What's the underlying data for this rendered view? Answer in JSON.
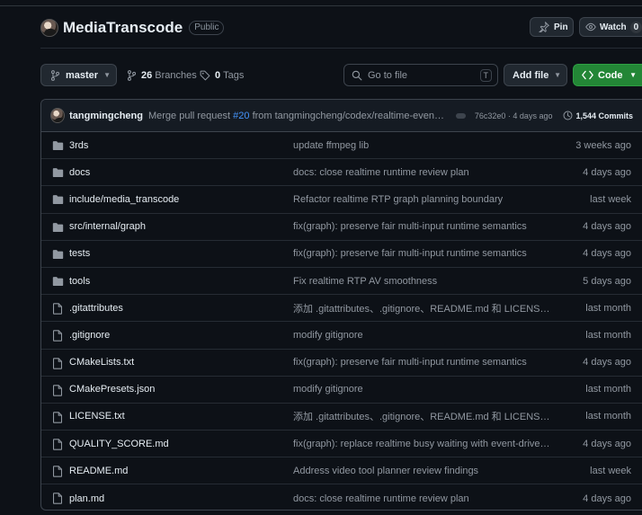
{
  "repo": {
    "name": "MediaTranscode",
    "visibility": "Public"
  },
  "header_buttons": {
    "pin": "Pin",
    "watch": "Watch",
    "watch_count": "0"
  },
  "toolbar": {
    "branch": "master",
    "branches_count": "26",
    "branches_label": "Branches",
    "tags_count": "0",
    "tags_label": "Tags",
    "goto_placeholder": "Go to file",
    "goto_kbd": "T",
    "add_file": "Add file",
    "code": "Code"
  },
  "latest_commit": {
    "user": "tangmingcheng",
    "msg_prefix": "Merge pull request ",
    "pr": "#20",
    "msg_suffix": " from tangmingcheng/codex/realtime-event-driv...",
    "hash_time": "76c32e0 · 4 days ago",
    "commits": "1,544 Commits"
  },
  "files": [
    {
      "name": "3rds",
      "type": "dir",
      "message": "update ffmpeg lib",
      "age": "3 weeks ago"
    },
    {
      "name": "docs",
      "type": "dir",
      "message": "docs: close realtime runtime review plan",
      "age": "4 days ago"
    },
    {
      "name": "include/media_transcode",
      "type": "dir",
      "message": "Refactor realtime RTP graph planning boundary",
      "age": "last week"
    },
    {
      "name": "src/internal/graph",
      "type": "dir",
      "message": "fix(graph): preserve fair multi-input runtime semantics",
      "age": "4 days ago"
    },
    {
      "name": "tests",
      "type": "dir",
      "message": "fix(graph): preserve fair multi-input runtime semantics",
      "age": "4 days ago"
    },
    {
      "name": "tools",
      "type": "dir",
      "message": "Fix realtime RTP AV smoothness",
      "age": "5 days ago"
    },
    {
      "name": ".gitattributes",
      "type": "file",
      "message": "添加 .gitattributes、.gitignore、README.md 和 LICENSE.txt",
      "age": "last month"
    },
    {
      "name": ".gitignore",
      "type": "file",
      "message": "modify gitignore",
      "age": "last month"
    },
    {
      "name": "CMakeLists.txt",
      "type": "file",
      "message": "fix(graph): preserve fair multi-input runtime semantics",
      "age": "4 days ago"
    },
    {
      "name": "CMakePresets.json",
      "type": "file",
      "message": "modify gitignore",
      "age": "last month"
    },
    {
      "name": "LICENSE.txt",
      "type": "file",
      "message": "添加 .gitattributes、.gitignore、README.md 和 LICENSE.txt",
      "age": "last month"
    },
    {
      "name": "QUALITY_SCORE.md",
      "type": "file",
      "message": "fix(graph): replace realtime busy waiting with event-driven sc...",
      "age": "4 days ago"
    },
    {
      "name": "README.md",
      "type": "file",
      "message": "Address video tool planner review findings",
      "age": "last week"
    },
    {
      "name": "plan.md",
      "type": "file",
      "message": "docs: close realtime runtime review plan",
      "age": "4 days ago"
    }
  ]
}
